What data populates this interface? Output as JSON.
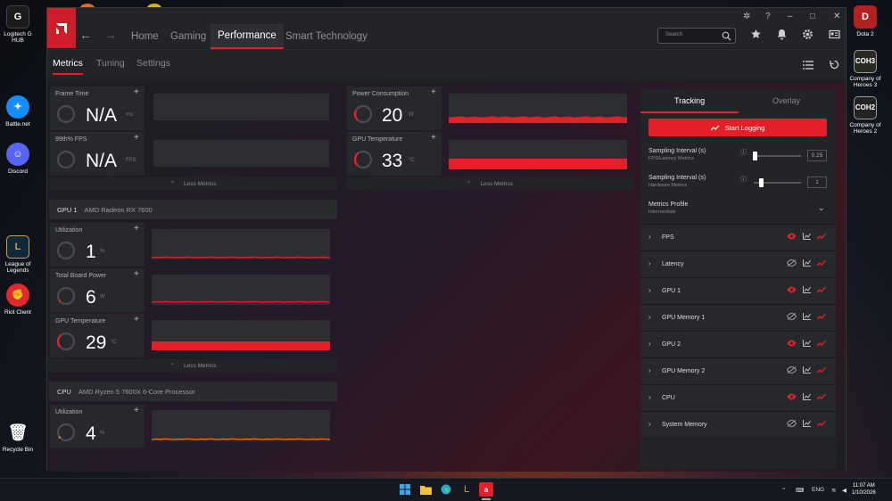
{
  "desktop": {
    "icons": [
      {
        "label": "Logitech G HUB"
      },
      {
        "label": "Battle.net"
      },
      {
        "label": "Discord"
      },
      {
        "label": "League of Legends"
      },
      {
        "label": "Riot Client"
      },
      {
        "label": "Recycle Bin"
      },
      {
        "label": "Dota 2"
      },
      {
        "label": "Company of Heroes 3"
      },
      {
        "label": "Company of Heroes 2"
      }
    ]
  },
  "nav": {
    "tabs": [
      "Home",
      "Gaming",
      "Performance",
      "Smart Technology"
    ],
    "active": "Performance",
    "search_placeholder": "Search"
  },
  "subnav": {
    "tabs": [
      "Metrics",
      "Tuning",
      "Settings"
    ],
    "active": "Metrics"
  },
  "metrics": {
    "frame_time": {
      "label": "Frame Time",
      "value": "N/A",
      "unit": "ms"
    },
    "fps99": {
      "label": "99th% FPS",
      "value": "N/A",
      "unit": "FPS"
    },
    "power": {
      "label": "Power Consumption",
      "value": "20",
      "unit": "W"
    },
    "temp_top": {
      "label": "GPU Temperature",
      "value": "33",
      "unit": "°C"
    },
    "less_metrics": "Less Metrics"
  },
  "gpu": {
    "section": "GPU 1",
    "name": "AMD Radeon RX 7600",
    "utilization": {
      "label": "Utilization",
      "value": "1",
      "unit": "%"
    },
    "board_power": {
      "label": "Total Board Power",
      "value": "6",
      "unit": "W"
    },
    "temperature": {
      "label": "GPU Temperature",
      "value": "29",
      "unit": "°C"
    }
  },
  "cpu": {
    "section": "CPU",
    "name": "AMD Ryzen 5 7600X 6-Core Processor",
    "utilization": {
      "label": "Utilization",
      "value": "4",
      "unit": "%"
    }
  },
  "tracking": {
    "tabs": [
      "Tracking",
      "Overlay"
    ],
    "active": "Tracking",
    "start_logging": "Start Logging",
    "sampling_fps": {
      "label": "Sampling Interval (s)",
      "sub": "FPS/Latency Metrics",
      "value": "0.25"
    },
    "sampling_hw": {
      "label": "Sampling Interval (s)",
      "sub": "Hardware Metrics",
      "value": "1"
    },
    "profile": {
      "label": "Metrics Profile",
      "value": "Intermediate"
    },
    "rows": [
      {
        "label": "FPS",
        "visible": true
      },
      {
        "label": "Latency",
        "visible": false
      },
      {
        "label": "GPU 1",
        "visible": true
      },
      {
        "label": "GPU Memory 1",
        "visible": false
      },
      {
        "label": "GPU 2",
        "visible": true
      },
      {
        "label": "GPU Memory 2",
        "visible": false
      },
      {
        "label": "CPU",
        "visible": true
      },
      {
        "label": "System Memory",
        "visible": false
      }
    ]
  },
  "taskbar": {
    "lang": "ENG",
    "time": "11:07 AM",
    "date": "1/10/2026"
  },
  "colors": {
    "accent": "#e31f2a",
    "cpu_line": "#e8701a"
  }
}
